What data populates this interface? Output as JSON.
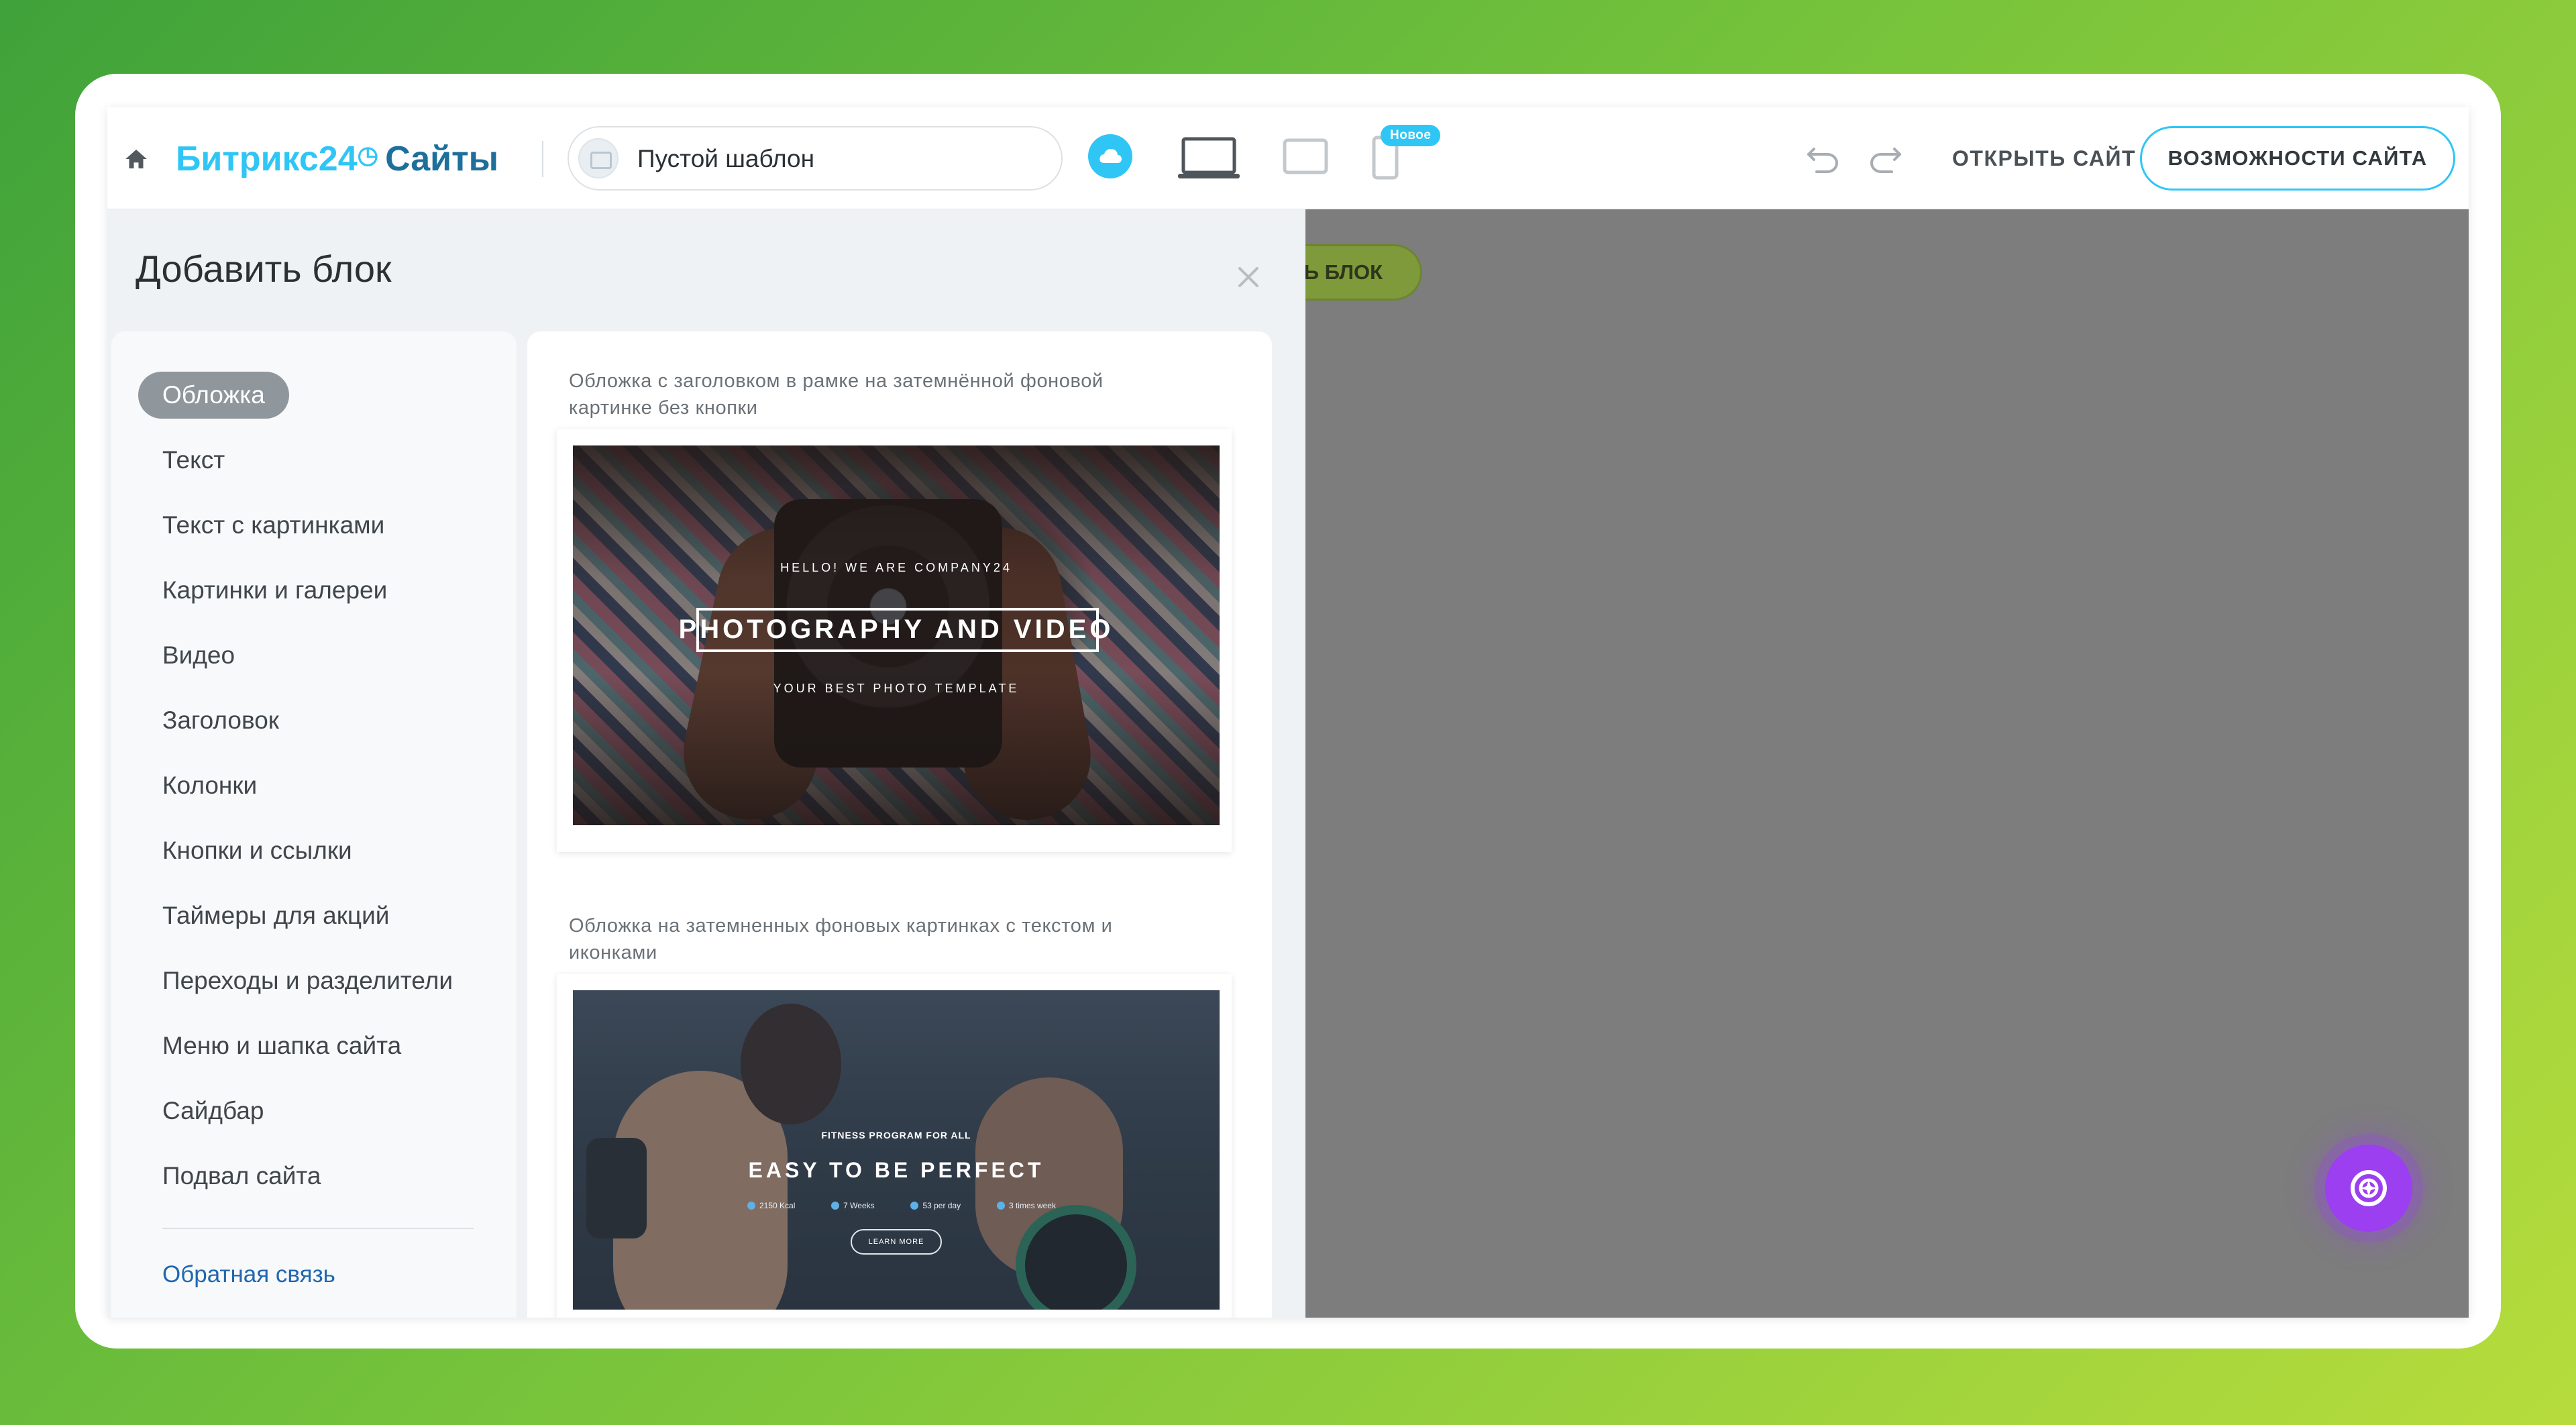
{
  "header": {
    "logo_main": "Битрикс24",
    "logo_clock": "◷",
    "logo_sites": "Сайты",
    "template_value": "Пустой шаблон",
    "new_badge": "Новое",
    "open_site_label": "ОТКРЫТЬ САЙТ",
    "features_label": "ВОЗМОЖНОСТИ САЙТА"
  },
  "panel": {
    "title": "Добавить блок",
    "categories": [
      {
        "label": "Обложка",
        "active": true
      },
      {
        "label": "Текст"
      },
      {
        "label": "Текст с картинками"
      },
      {
        "label": "Картинки и галереи"
      },
      {
        "label": "Видео"
      },
      {
        "label": "Заголовок"
      },
      {
        "label": "Колонки"
      },
      {
        "label": "Кнопки и ссылки"
      },
      {
        "label": "Таймеры для акций"
      },
      {
        "label": "Переходы и разделители"
      },
      {
        "label": "Меню и шапка сайта"
      },
      {
        "label": "Сайдбар"
      },
      {
        "label": "Подвал сайта"
      }
    ],
    "feedback_label": "Обратная связь",
    "cards": [
      {
        "description": "Обложка с заголовком в рамке на затемнённой фоновой картинке без кнопки",
        "preview_small": "HELLO! WE ARE COMPANY24",
        "preview_title": "PHOTOGRAPHY AND VIDEO",
        "preview_sub": "YOUR BEST PHOTO TEMPLATE"
      },
      {
        "description": "Обложка на затемненных фоновых картинках с текстом и иконками",
        "preview_small": "FITNESS PROGRAM FOR ALL",
        "preview_title": "EASY TO BE PERFECT",
        "preview_stats": [
          "2150 Kcal",
          "7 Weeks",
          "53 per day",
          "3 times week"
        ],
        "preview_button": "LEARN MORE"
      }
    ]
  },
  "canvas": {
    "add_block_label": "ТЬ БЛОК"
  },
  "colors": {
    "accent": "#2fc6f6",
    "brand_dark": "#1d6f9c",
    "canvas_bg": "#7d7d7d",
    "add_block_pill": "#7e9a3b",
    "fab": "#9b3ff0"
  }
}
